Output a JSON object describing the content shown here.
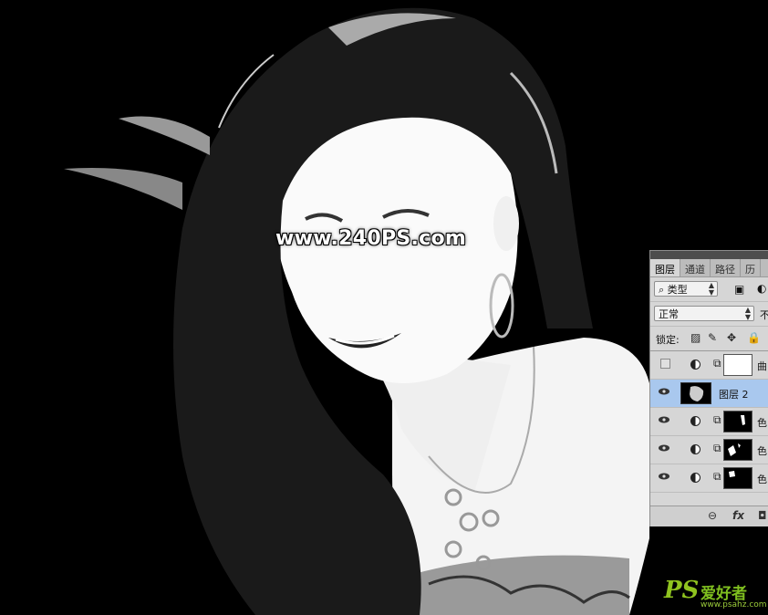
{
  "watermark": "www.240PS.com",
  "site_mark": {
    "logo": "PS",
    "name": "爱好者",
    "url": "www.psahz.com"
  },
  "panel": {
    "tabs": [
      "图层",
      "通道",
      "路径",
      "历"
    ],
    "filter_kind": "类型",
    "blend_mode": "正常",
    "opacity_label_truncated": "不",
    "lock_label": "锁定:",
    "layers": [
      {
        "name": "曲",
        "visible": false,
        "type": "adjustment",
        "selected": false
      },
      {
        "name": "图层 2",
        "visible": true,
        "type": "pixel",
        "selected": true
      },
      {
        "name": "色",
        "visible": true,
        "type": "adjustment",
        "selected": false
      },
      {
        "name": "色",
        "visible": true,
        "type": "adjustment",
        "selected": false
      },
      {
        "name": "色",
        "visible": true,
        "type": "adjustment",
        "selected": false
      }
    ],
    "footer_icons": [
      "link-icon",
      "fx-icon",
      "mask-icon"
    ]
  }
}
